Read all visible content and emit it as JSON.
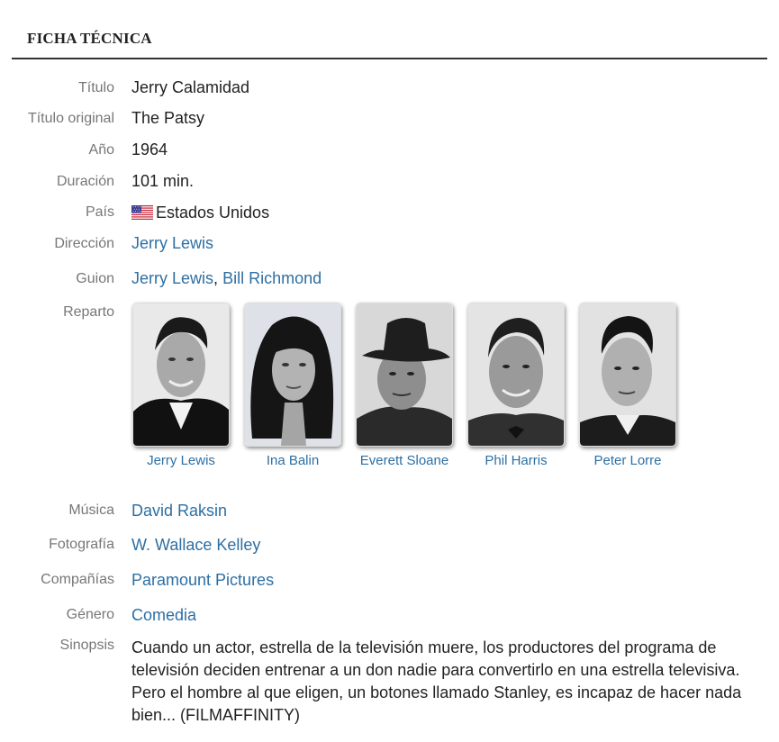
{
  "header": {
    "title": "FICHA TÉCNICA"
  },
  "fields": {
    "titulo": {
      "label": "Título",
      "value": "Jerry Calamidad"
    },
    "titulo_original": {
      "label": "Título original",
      "value": "The Patsy"
    },
    "anio": {
      "label": "Año",
      "value": "1964"
    },
    "duracion": {
      "label": "Duración",
      "value": "101 min."
    },
    "pais": {
      "label": "País",
      "value": "Estados Unidos",
      "flag_icon": "us-flag-icon"
    },
    "direccion": {
      "label": "Dirección",
      "value": "Jerry Lewis"
    },
    "guion": {
      "label": "Guion",
      "values": [
        "Jerry Lewis",
        "Bill Richmond"
      ],
      "separator": ","
    },
    "reparto": {
      "label": "Reparto"
    },
    "musica": {
      "label": "Música",
      "value": "David Raksin"
    },
    "fotografia": {
      "label": "Fotografía",
      "value": "W. Wallace Kelley"
    },
    "companias": {
      "label": "Compañías",
      "value": "Paramount Pictures"
    },
    "genero": {
      "label": "Género",
      "value": "Comedia"
    },
    "sinopsis": {
      "label": "Sinopsis",
      "value": "Cuando un actor, estrella de la televisión muere, los productores del programa de televisión deciden entrenar a un don nadie para convertirlo en una estrella televisiva. Pero el hombre al que eligen, un botones llamado Stanley, es incapaz de hacer nada bien... (FILMAFFINITY)"
    }
  },
  "cast": [
    {
      "name": "Jerry Lewis"
    },
    {
      "name": "Ina Balin"
    },
    {
      "name": "Everett Sloane"
    },
    {
      "name": "Phil Harris"
    },
    {
      "name": "Peter Lorre"
    }
  ],
  "colors": {
    "link": "#2d6fa3",
    "label": "#777777",
    "text": "#222222",
    "rule": "#333333"
  }
}
